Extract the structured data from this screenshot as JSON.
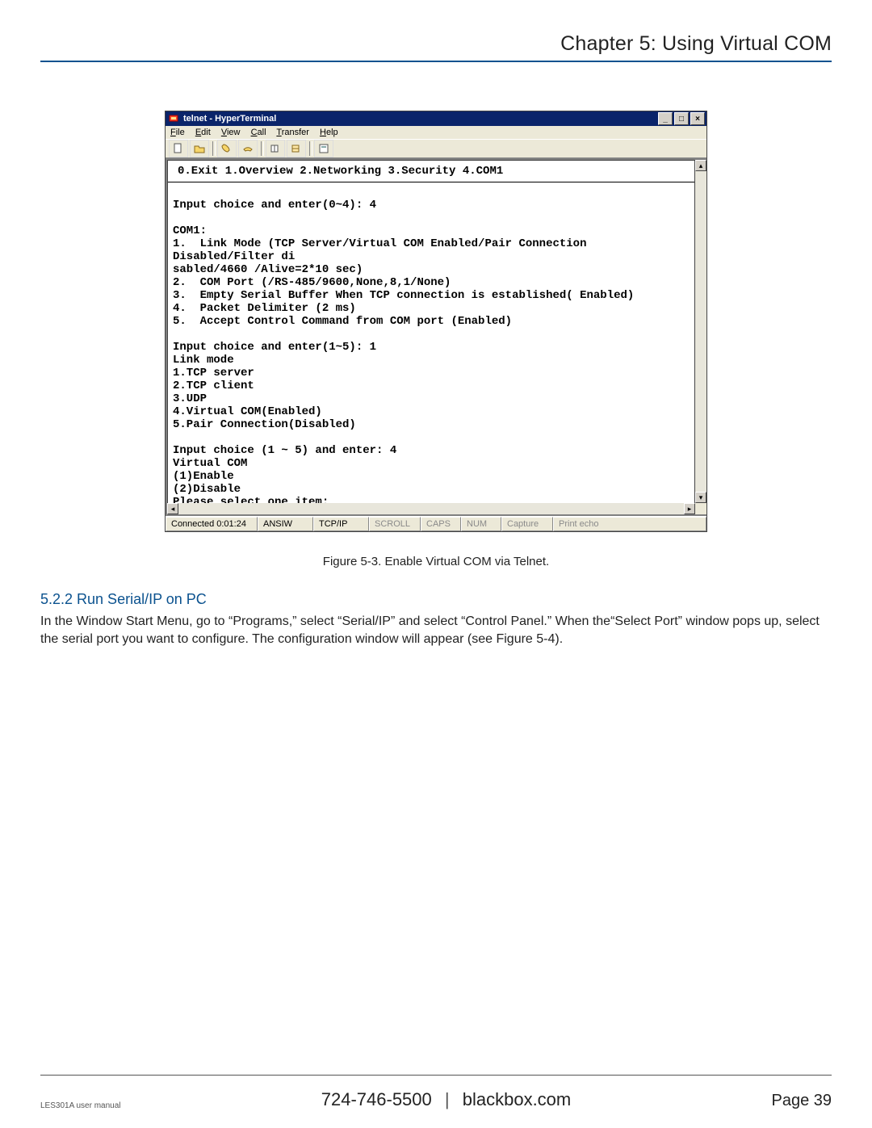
{
  "page": {
    "chapter_title": "Chapter 5: Using Virtual COM",
    "figure_caption": "Figure 5-3. Enable Virtual COM via Telnet.",
    "section_heading": "5.2.2 Run Serial/IP on PC",
    "section_body": "In the Window Start Menu, go to “Programs,” select “Serial/IP” and select “Control Panel.”  When the“Select Port” window pops up, select the serial port you want to configure. The configuration window will appear (see Figure 5-4).",
    "footer_manual": "LES301A user manual",
    "footer_phone": "724-746-5500",
    "footer_site": "blackbox.com",
    "footer_page": "Page 39"
  },
  "hyperterminal": {
    "window_title": "telnet - HyperTerminal",
    "menu": {
      "file": "File",
      "edit": "Edit",
      "view": "View",
      "call": "Call",
      "transfer": "Transfer",
      "help": "Help"
    },
    "toolbar_icons": [
      "new-file-icon",
      "open-icon",
      "phone-icon",
      "hangup-icon",
      "send-icon",
      "receive-icon",
      "properties-icon"
    ],
    "tabstrip": "0.Exit  1.Overview  2.Networking  3.Security  4.COM1",
    "terminal_text": "\nInput choice and enter(0~4): 4\n\nCOM1:\n1.  Link Mode (TCP Server/Virtual COM Enabled/Pair Connection Disabled/Filter di\nsabled/4660 /Alive=2*10 sec)\n2.  COM Port (/RS-485/9600,None,8,1/None)\n3.  Empty Serial Buffer When TCP connection is established( Enabled)\n4.  Packet Delimiter (2 ms)\n5.  Accept Control Command from COM port (Enabled)\n\nInput choice and enter(1~5): 1\nLink mode\n1.TCP server\n2.TCP client\n3.UDP\n4.Virtual COM(Enabled)\n5.Pair Connection(Disabled)\n\nInput choice (1 ~ 5) and enter: 4\nVirtual COM\n(1)Enable\n(2)Disable\nPlease select one item:",
    "status": {
      "connected": "Connected 0:01:24",
      "emulation": "ANSIW",
      "protocol": "TCP/IP",
      "scroll": "SCROLL",
      "caps": "CAPS",
      "num": "NUM",
      "capture": "Capture",
      "printecho": "Print echo"
    }
  }
}
